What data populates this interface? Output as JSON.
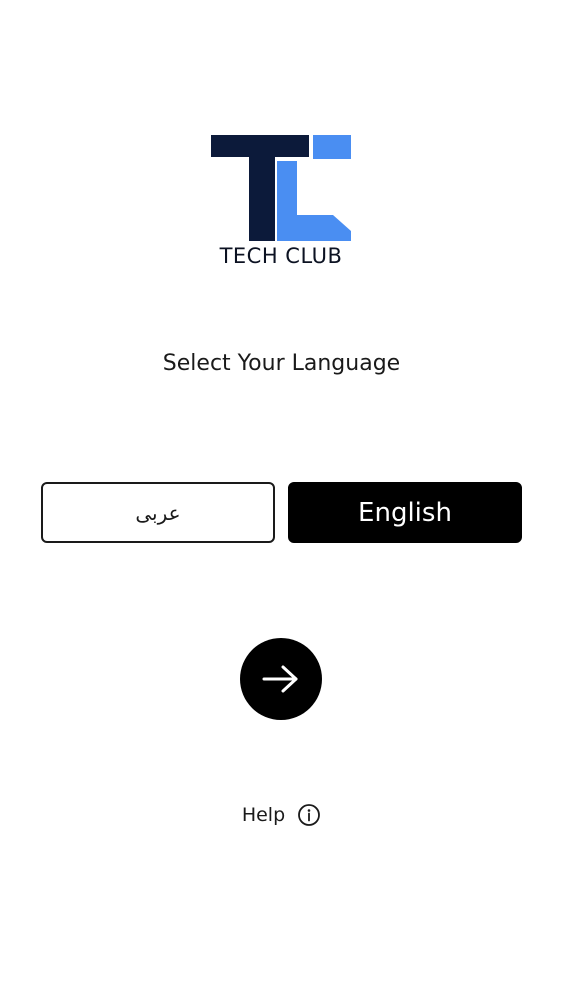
{
  "brand": {
    "logo_text": "TECH CLUB",
    "colors": {
      "dark": "#0c1a3a",
      "accent": "#4a8ef2"
    }
  },
  "main": {
    "title": "Select Your Language",
    "languages": [
      {
        "label": "عربى",
        "selected": false
      },
      {
        "label": "English",
        "selected": true
      }
    ],
    "next_icon": "arrow-right-icon"
  },
  "footer": {
    "help_label": "Help",
    "help_icon": "info-icon"
  }
}
